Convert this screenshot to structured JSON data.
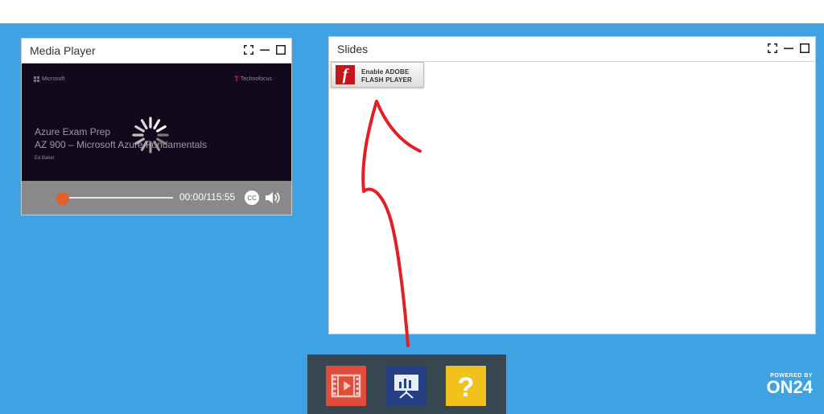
{
  "media_player": {
    "title": "Media Player",
    "video": {
      "brand_left": "Microsoft",
      "brand_right": "Technofocus",
      "title_line1": "Azure Exam Prep",
      "title_line2": "AZ 900 – Microsoft Azure Fundamentals",
      "author": "Ed Baker"
    },
    "time": "00:00/115:55",
    "progress": 0,
    "cc_label": "CC"
  },
  "slides": {
    "title": "Slides",
    "flash_button": {
      "line1": "Enable ADOBE",
      "line2": "FLASH PLAYER",
      "icon_letter": "f"
    }
  },
  "dock": {
    "items": [
      {
        "name": "media-player",
        "icon": "film-icon",
        "color": "#e04d3b"
      },
      {
        "name": "slides",
        "icon": "presentation-icon",
        "color": "#243f84"
      },
      {
        "name": "help",
        "icon": "question-icon",
        "color": "#f1c21b",
        "label": "?"
      }
    ]
  },
  "footer": {
    "powered_by": "POWERED BY",
    "brand": "ON24"
  },
  "colors": {
    "background": "#3fa3e3",
    "dock": "#37474f",
    "annotation_arrow": "#e31e24"
  }
}
